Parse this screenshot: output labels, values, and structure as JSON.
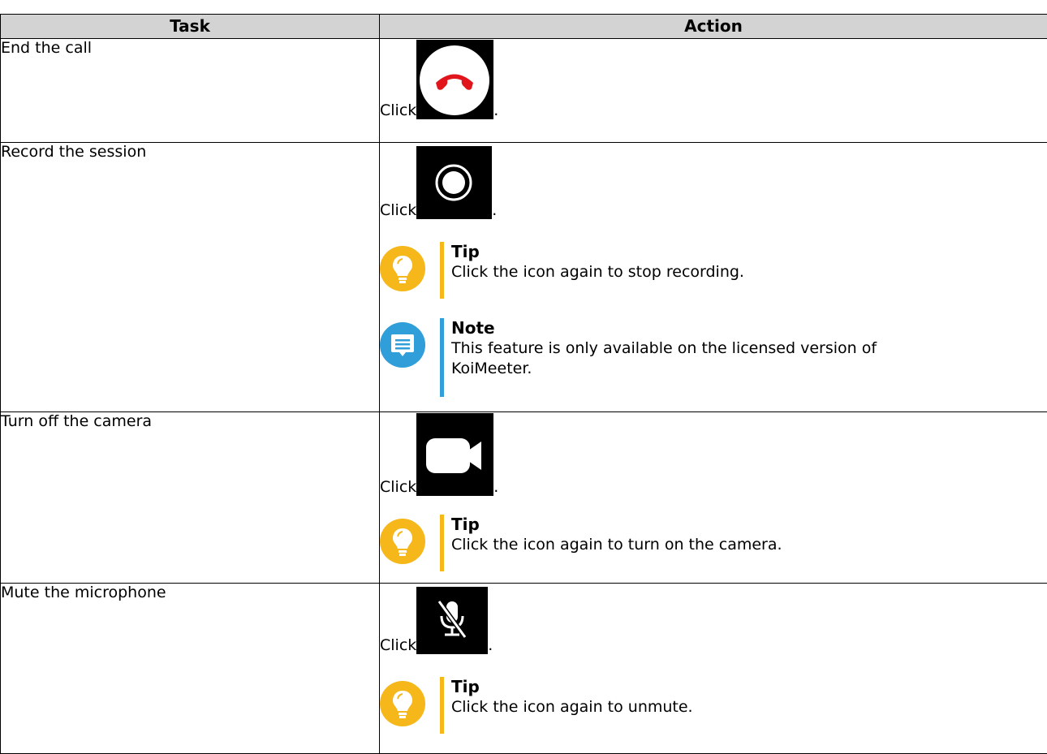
{
  "table": {
    "header": {
      "task": "Task",
      "action": "Action"
    },
    "click_word": "Click",
    "period": ".",
    "rows": [
      {
        "task": "End the call",
        "icon": "end-call-icon"
      },
      {
        "task": "Record the session",
        "icon": "record-icon",
        "tip": {
          "title": "Tip",
          "body": "Click the icon again to stop recording."
        },
        "note": {
          "title": "Note",
          "body": "This feature is only available on the licensed version of KoiMeeter."
        }
      },
      {
        "task": "Turn off the camera",
        "icon": "camera-icon",
        "tip": {
          "title": "Tip",
          "body": "Click the icon again to turn on the camera."
        }
      },
      {
        "task": "Mute the microphone",
        "icon": "microphone-mute-icon",
        "tip": {
          "title": "Tip",
          "body": "Click the icon again to unmute."
        }
      }
    ]
  },
  "colors": {
    "header_bg": "#d3d3d3",
    "tip_accent": "#f5b71a",
    "note_accent": "#2f9ed9",
    "end_call_red": "#e0161c"
  }
}
